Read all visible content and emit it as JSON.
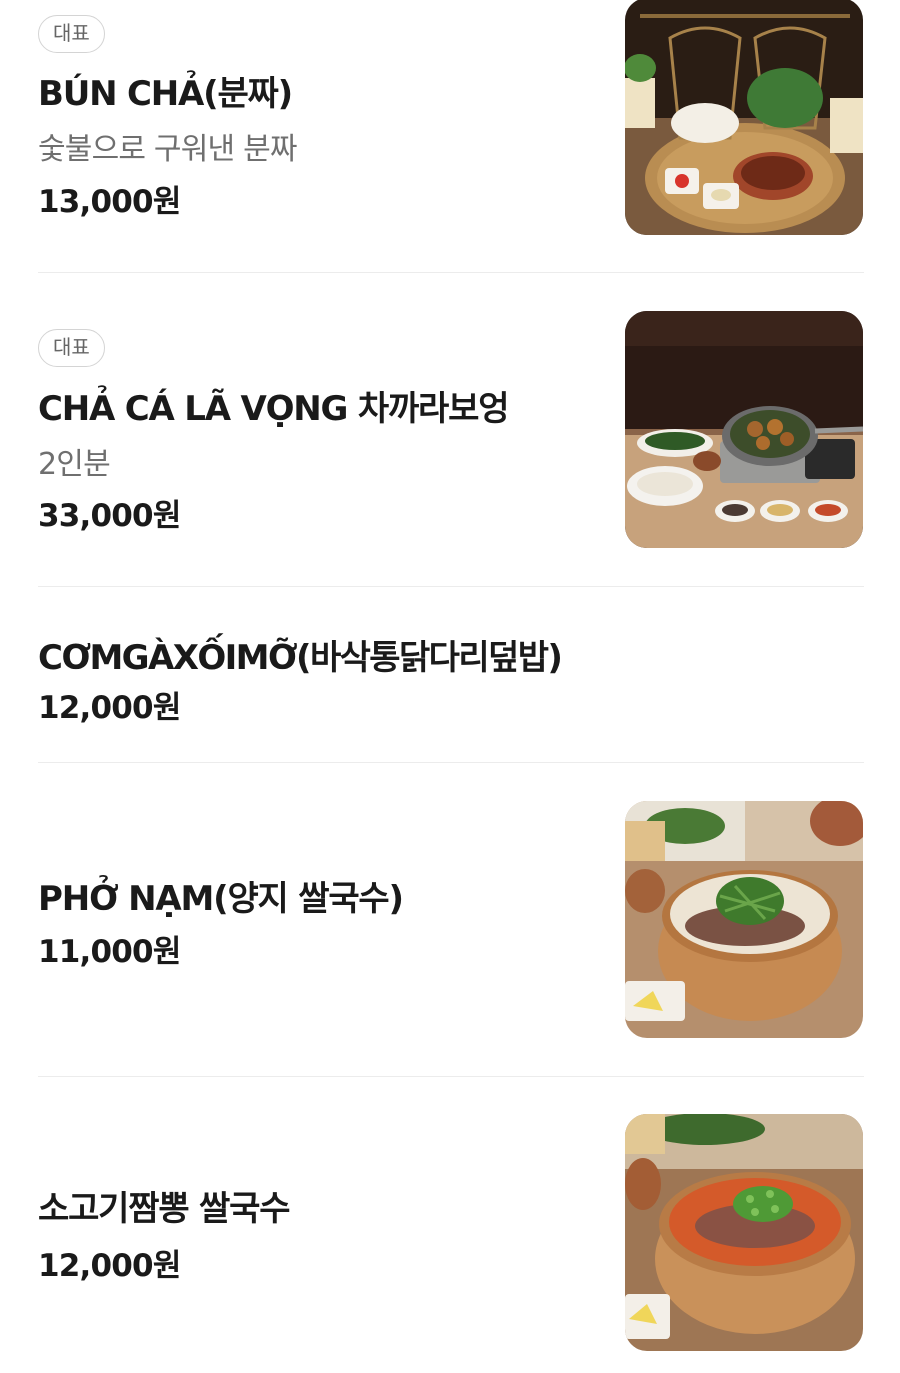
{
  "menu": {
    "items": [
      {
        "badge": "대표",
        "name": "BÚN CHẢ(분짜)",
        "description": "숯불으로 구워낸 분짜",
        "price": "13,000원",
        "photo": "bun-cha-photo"
      },
      {
        "badge": "대표",
        "name": "CHẢ CÁ LÃ VỌNG 차까라보엉",
        "description": "2인분",
        "price": "33,000원",
        "photo": "cha-ca-photo"
      },
      {
        "name": "CƠMGÀXỐIMỠ(바삭통닭다리덮밥)",
        "price": "12,000원"
      },
      {
        "name": "PHỞ NẠM(양지 쌀국수)",
        "price": "11,000원",
        "photo": "pho-nam-photo"
      },
      {
        "name": "소고기짬뽕 쌀국수",
        "price": "12,000원",
        "photo": "beef-jjamppong-pho-photo"
      }
    ]
  },
  "colors": {
    "text_primary": "#1a1a1a",
    "text_secondary": "#6f6f6f",
    "badge_border": "#d4d4d4",
    "divider": "#ececec",
    "background": "#ffffff"
  }
}
